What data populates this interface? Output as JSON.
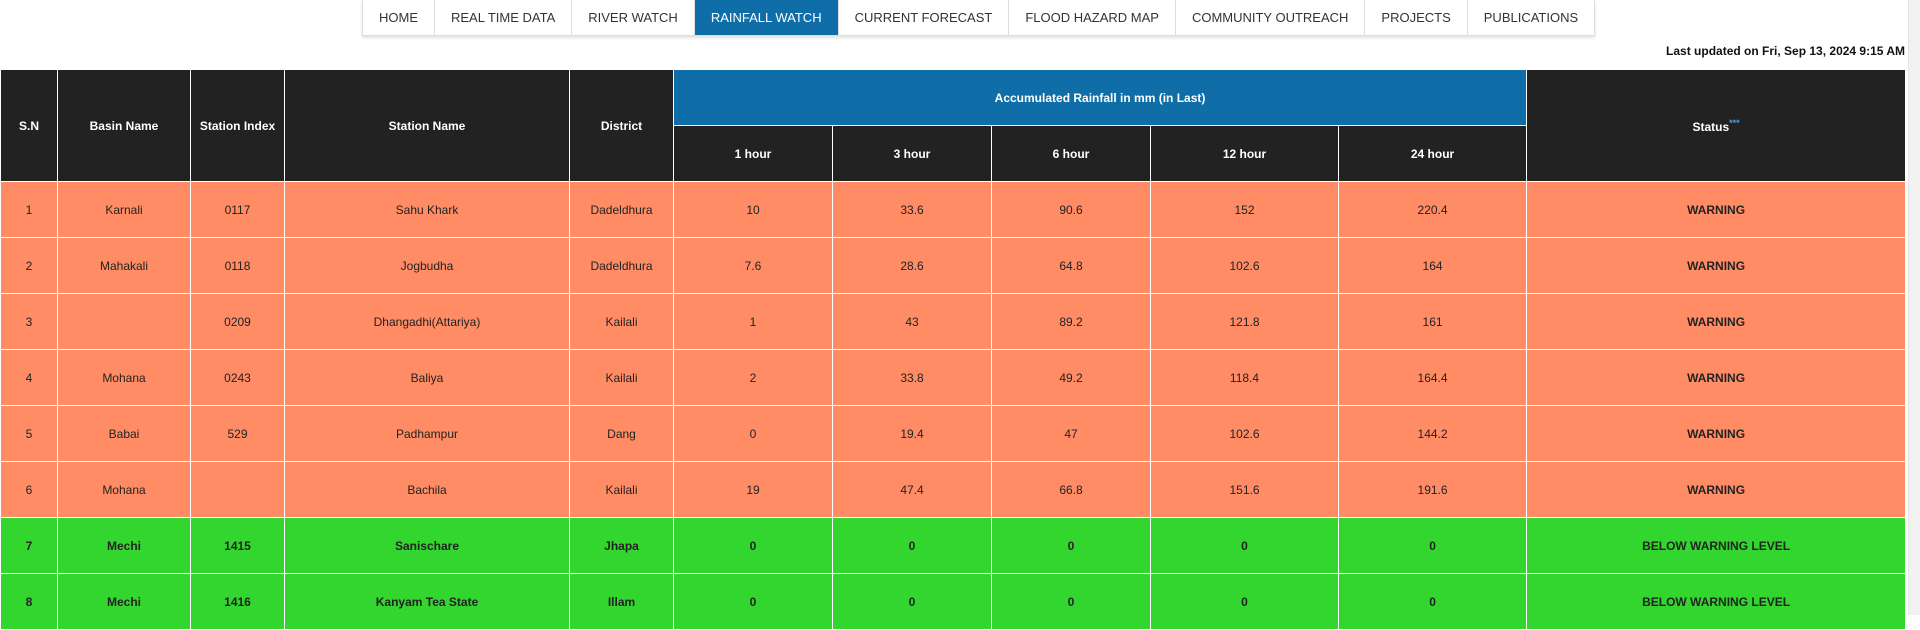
{
  "nav": {
    "items": [
      {
        "label": "HOME",
        "active": false
      },
      {
        "label": "REAL TIME DATA",
        "active": false
      },
      {
        "label": "RIVER WATCH",
        "active": false
      },
      {
        "label": "RAINFALL WATCH",
        "active": true
      },
      {
        "label": "CURRENT FORECAST",
        "active": false
      },
      {
        "label": "FLOOD HAZARD MAP",
        "active": false
      },
      {
        "label": "COMMUNITY OUTREACH",
        "active": false
      },
      {
        "label": "PROJECTS",
        "active": false
      },
      {
        "label": "PUBLICATIONS",
        "active": false
      }
    ],
    "active_color": "#0f6ea8"
  },
  "last_updated": "Last updated on Fri, Sep 13, 2024 9:15 AM",
  "table": {
    "headers": {
      "sn": "S.N",
      "basin": "Basin Name",
      "index": "Station Index",
      "station": "Station Name",
      "district": "District",
      "accumulated": "Accumulated Rainfall in mm (in Last)",
      "h1": "1 hour",
      "h3": "3 hour",
      "h6": "6 hour",
      "h12": "12 hour",
      "h24": "24 hour",
      "status": "Status",
      "status_mark": "***"
    },
    "colors": {
      "header": "#222222",
      "accumulated_header": "#0f6ea8",
      "warning": "#ff8c64",
      "below_warning": "#33d62e"
    },
    "rows": [
      {
        "sn": "1",
        "basin": "Karnali",
        "index": "0117",
        "station": "Sahu Khark",
        "district": "Dadeldhura",
        "h1": "10",
        "h3": "33.6",
        "h6": "90.6",
        "h12": "152",
        "h24": "220.4",
        "status": "WARNING",
        "level": "warn"
      },
      {
        "sn": "2",
        "basin": "Mahakali",
        "index": "0118",
        "station": "Jogbudha",
        "district": "Dadeldhura",
        "h1": "7.6",
        "h3": "28.6",
        "h6": "64.8",
        "h12": "102.6",
        "h24": "164",
        "status": "WARNING",
        "level": "warn"
      },
      {
        "sn": "3",
        "basin": "",
        "index": "0209",
        "station": "Dhangadhi(Attariya)",
        "district": "Kailali",
        "h1": "1",
        "h3": "43",
        "h6": "89.2",
        "h12": "121.8",
        "h24": "161",
        "status": "WARNING",
        "level": "warn"
      },
      {
        "sn": "4",
        "basin": "Mohana",
        "index": "0243",
        "station": "Baliya",
        "district": "Kailali",
        "h1": "2",
        "h3": "33.8",
        "h6": "49.2",
        "h12": "118.4",
        "h24": "164.4",
        "status": "WARNING",
        "level": "warn"
      },
      {
        "sn": "5",
        "basin": "Babai",
        "index": "529",
        "station": "Padhampur",
        "district": "Dang",
        "h1": "0",
        "h3": "19.4",
        "h6": "47",
        "h12": "102.6",
        "h24": "144.2",
        "status": "WARNING",
        "level": "warn"
      },
      {
        "sn": "6",
        "basin": "Mohana",
        "index": "",
        "station": "Bachila",
        "district": "Kailali",
        "h1": "19",
        "h3": "47.4",
        "h6": "66.8",
        "h12": "151.6",
        "h24": "191.6",
        "status": "WARNING",
        "level": "warn"
      },
      {
        "sn": "7",
        "basin": "Mechi",
        "index": "1415",
        "station": "Sanischare",
        "district": "Jhapa",
        "h1": "0",
        "h3": "0",
        "h6": "0",
        "h12": "0",
        "h24": "0",
        "status": "BELOW WARNING LEVEL",
        "level": "ok"
      },
      {
        "sn": "8",
        "basin": "Mechi",
        "index": "1416",
        "station": "Kanyam Tea State",
        "district": "Illam",
        "h1": "0",
        "h3": "0",
        "h6": "0",
        "h12": "0",
        "h24": "0",
        "status": "BELOW WARNING LEVEL",
        "level": "ok"
      }
    ]
  }
}
